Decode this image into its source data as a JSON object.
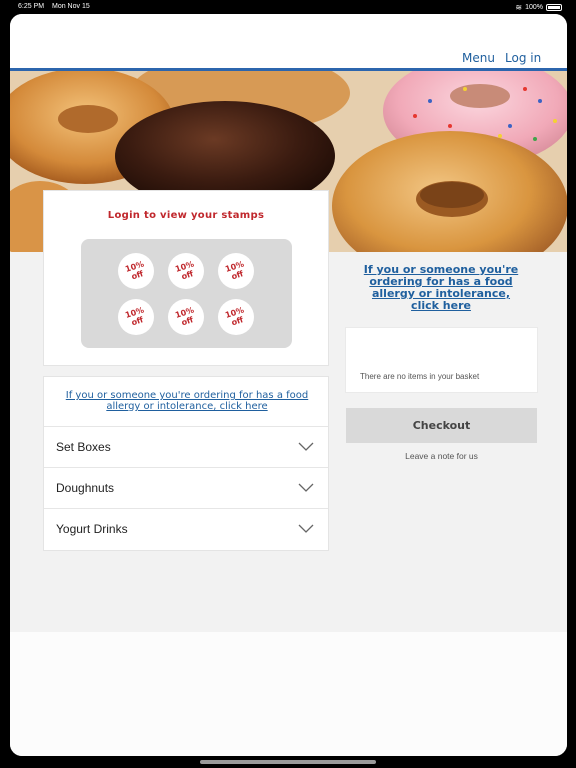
{
  "status_bar": {
    "time": "6:25 PM",
    "date": "Mon Nov 15",
    "battery": "100%"
  },
  "nav": {
    "menu": "Menu",
    "login": "Log in"
  },
  "accent_color": "#2c65ad",
  "link_color": "#1f5f9e",
  "stamps": {
    "title": "Login to view your stamps",
    "stamp_label": "10% off",
    "count": 6
  },
  "allergy_notice": "If you or someone you're ordering for has a food allergy or intolerance, click here",
  "categories": [
    {
      "label": "Set Boxes"
    },
    {
      "label": "Doughnuts"
    },
    {
      "label": "Yogurt Drinks"
    }
  ],
  "basket": {
    "empty_message": "There are no items in your basket",
    "checkout_label": "Checkout",
    "leave_note": "Leave a note for us"
  }
}
